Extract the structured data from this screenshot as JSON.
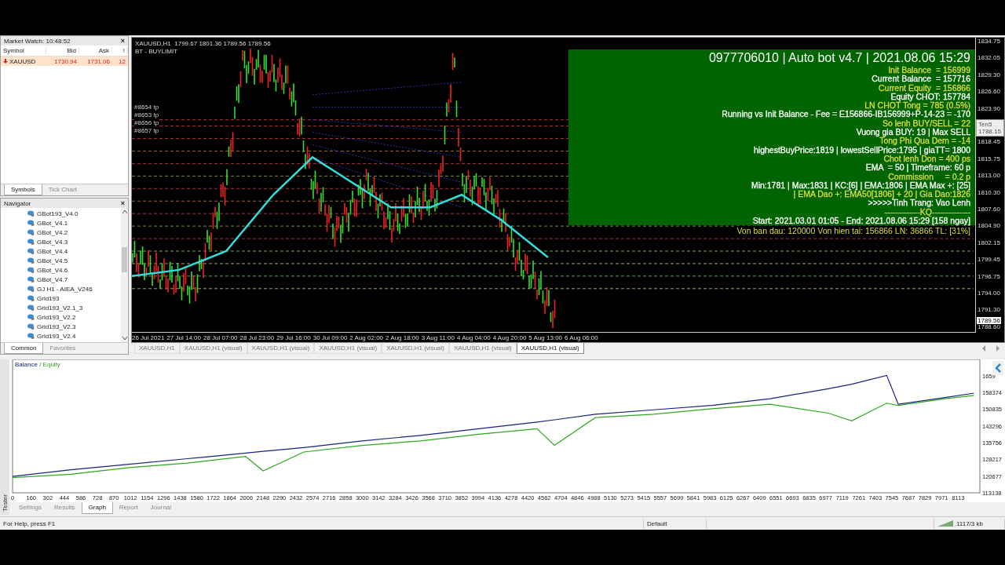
{
  "market_watch": {
    "title": "Market Watch: 10:48:52",
    "close": "×",
    "columns": [
      "Symbol",
      "Bid",
      "Ask",
      "!"
    ],
    "rows": [
      {
        "symbol": "XAUUSD",
        "bid": "1730.94",
        "ask": "1731.06",
        "spread": "12"
      }
    ],
    "tabs": [
      {
        "label": "Symbols",
        "selected": true
      },
      {
        "label": "Tick Chart",
        "selected": false
      }
    ]
  },
  "navigator": {
    "title": "Navigator",
    "close": "×",
    "items": [
      "GBot193_V4.0",
      "GBot_V4.1",
      "GBot_V4.2",
      "GBot_V4.3",
      "GBot_V4.4",
      "GBot_V4.5",
      "GBot_V4.6",
      "GBot_V4.7",
      "GJ H1 - AIEA_V246",
      "Grid193",
      "Grid193_V2.1_3",
      "Grid193_V2.2",
      "Grid193_V2.3",
      "Grid193_V2.4"
    ],
    "tabs": [
      {
        "label": "Common",
        "selected": true
      },
      {
        "label": "Favorites",
        "selected": false
      }
    ]
  },
  "chart": {
    "header": "XAUUSD,H1  1799.67 1801.36 1789.56 1789.56",
    "subheader": "BT - BUYLIMIT",
    "order_labels": [
      "#8654 tp",
      "#8653 tp",
      "#8656 tp",
      "#8657 tp"
    ],
    "info_panel": {
      "title": "0977706010 | Auto bot v4.7 | 2021.08.06 15:29",
      "lines": [
        {
          "text": "Init Balance  = 156999",
          "color": "#dede3c"
        },
        {
          "text": "Current Balance  = 157716",
          "color": "#ffffff"
        },
        {
          "text": "Current Equity  = 156866",
          "color": "#dede3c"
        },
        {
          "text": "Equity CHOT: 157784",
          "color": "#ffffff"
        },
        {
          "text": "LN CHOT Tong = 785 (0.5%)",
          "color": "#dede3c"
        },
        {
          "text": "Running vs Init Balance - Fee = E156866-IB156999+P-14-23 = -170",
          "color": "#ffffff"
        },
        {
          "text": "So lenh BUY/SELL = 22",
          "color": "#dede3c"
        },
        {
          "text": "Vuong gia BUY: 19 | Max SELL",
          "color": "#ffffff"
        },
        {
          "text": "Tong Phi Qua Dem = -14",
          "color": "#dede3c"
        },
        {
          "text": "highestBuyPrice:1819 | lowestSellPrice:1795 | giaTT= 1800",
          "color": "#ffffff"
        },
        {
          "text": "Chot lenh Don = 400 ps",
          "color": "#dede3c"
        },
        {
          "text": "EMA  = 50 | Timeframe: 60 p",
          "color": "#ffffff"
        },
        {
          "text": "Commission     = 0.2 p",
          "color": "#dede3c"
        },
        {
          "text": "Min:1781 | Max:1831 | KC:[6] | EMA:1806 | EMA Max +: [25]",
          "color": "#ffffff"
        },
        {
          "text": "| EMA Dao +: EMA50[1806] + 20 | Gia Dao:1826",
          "color": "#dede3c"
        },
        {
          "text": ">>>>>Tinh Trang: Vao Lenh",
          "color": "#ffffff"
        },
        {
          "text": "-------------KQ--------------",
          "color": "#dede3c"
        },
        {
          "text": "Start: 2021.03.01 01:05 - End: 2021.08.06 15:29 [158 ngay]",
          "color": "#ffffff"
        }
      ]
    },
    "footer_line": "Von ban dau: 120000 Von hien tai: 156866 LN: 36866 TL: [31%]",
    "tooltip": [
      "Ten5",
      "1788.15"
    ],
    "price_axis_upper": [
      "1834.75",
      "1832.05",
      "1829.30",
      "1826.60",
      "1823.90"
    ],
    "price_axis_lower": [
      "1818.45",
      "1815.75",
      "1813.00",
      "1810.30",
      "1807.60",
      "1804.90",
      "1802.15",
      "1799.45",
      "1796.75",
      "1794.00",
      "1791.30",
      "1788.60"
    ],
    "current_price": "1789.56",
    "time_axis": [
      "26 Jul 2021",
      "27 Jul 14:00",
      "28 Jul 07:00",
      "28 Jul 23:00",
      "29 Jul 16:00",
      "30 Jul 09:00",
      "2 Aug 02:00",
      "2 Aug 18:00",
      "3 Aug 11:00",
      "4 Aug 04:00",
      "4 Aug 20:00",
      "5 Aug 13:00",
      "6 Aug 06:00"
    ]
  },
  "chart_tabs": [
    {
      "label": "XAUUSD,H1",
      "selected": false
    },
    {
      "label": "XAUUSD,H1 (visual)",
      "selected": false
    },
    {
      "label": "XAUUSD,H1 (visual)",
      "selected": false
    },
    {
      "label": "XAUUSD,H1 (visual)",
      "selected": false
    },
    {
      "label": "XAUUSD,H1 (visual)",
      "selected": false
    },
    {
      "label": "XAUUSD,H1 (visual)",
      "selected": false
    },
    {
      "label": "XAUUSD,H1 (visual)",
      "selected": true
    }
  ],
  "tester": {
    "side_label": "Tester",
    "legend_separator": "/",
    "chart_data": {
      "type": "line",
      "x": [
        0,
        500,
        1000,
        1500,
        2000,
        2150,
        2500,
        3000,
        3500,
        4000,
        4500,
        4650,
        5000,
        5500,
        6000,
        6500,
        7000,
        7200,
        7500,
        7600,
        8000,
        8250
      ],
      "series": [
        {
          "name": "Balance",
          "color": "#1a237e",
          "values": [
            120500,
            123500,
            126000,
            128500,
            131000,
            131800,
            133500,
            136500,
            139000,
            142000,
            145000,
            146000,
            148500,
            150500,
            152500,
            155500,
            160000,
            162000,
            166000,
            153000,
            156000,
            158000
          ]
        },
        {
          "name": "Equity",
          "color": "#2eaa1e",
          "values": [
            120000,
            121500,
            124500,
            126500,
            129500,
            123000,
            131500,
            134500,
            136500,
            139500,
            142000,
            134500,
            147000,
            148500,
            151000,
            153000,
            149000,
            145500,
            153500,
            152500,
            155500,
            157000
          ]
        }
      ],
      "xlim": [
        0,
        8300
      ],
      "ylim": [
        113138,
        173200
      ],
      "xticks": [
        0,
        160,
        302,
        444,
        586,
        728,
        870,
        1012,
        1154,
        1296,
        1438,
        1580,
        1722,
        1864,
        2006,
        2148,
        2290,
        2432,
        2574,
        2716,
        2858,
        3000,
        3142,
        3284,
        3426,
        3568,
        3710,
        3852,
        3994,
        4136,
        4278,
        4420,
        4562,
        4704,
        4846,
        4988,
        5130,
        5273,
        5415,
        5557,
        5699,
        5841,
        5983,
        6125,
        6267,
        6409,
        6551,
        6693,
        6835,
        6977,
        7119,
        7261,
        7403,
        7545,
        7687,
        7829,
        7971,
        8113
      ],
      "yticks": [
        113138,
        120677,
        128217,
        135756,
        143296,
        150835,
        158374
      ]
    },
    "cut_tick_label": "1659",
    "tabs": [
      {
        "label": "Settings",
        "selected": false
      },
      {
        "label": "Results",
        "selected": false
      },
      {
        "label": "Graph",
        "selected": true
      },
      {
        "label": "Report",
        "selected": false
      },
      {
        "label": "Journal",
        "selected": false
      }
    ]
  },
  "status_bar": {
    "help": "For Help, press F1",
    "profile": "Default",
    "traffic": "1117/3 kb"
  }
}
